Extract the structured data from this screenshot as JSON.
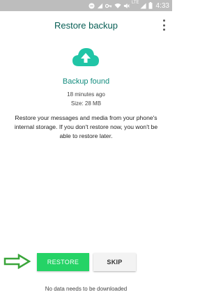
{
  "status_bar": {
    "time": "4:33",
    "network": "LTE",
    "icons": [
      "no-disturb-icon",
      "signal-icon",
      "key-icon",
      "wifi-icon",
      "mute-icon",
      "cell-signal-icon",
      "battery-icon"
    ]
  },
  "header": {
    "title": "Restore backup",
    "menu_icon": "more-vert-icon"
  },
  "backup": {
    "icon": "cloud-upload-icon",
    "title": "Backup found",
    "time_ago": "18 minutes ago",
    "size": "Size: 28 MB",
    "description": "Restore your messages and media from your phone's internal storage. If you don't restore now, you won't be able to restore later."
  },
  "actions": {
    "restore_label": "RESTORE",
    "skip_label": "SKIP",
    "arrow_icon": "arrow-right-icon"
  },
  "footer": {
    "note": "No data needs to be downloaded"
  },
  "colors": {
    "status_bar": "#bdbdbd",
    "title": "#075e54",
    "accent": "#128c7e",
    "restore_button": "#25d366",
    "cloud": "#20c5a6",
    "arrow": "#3aa53a"
  }
}
